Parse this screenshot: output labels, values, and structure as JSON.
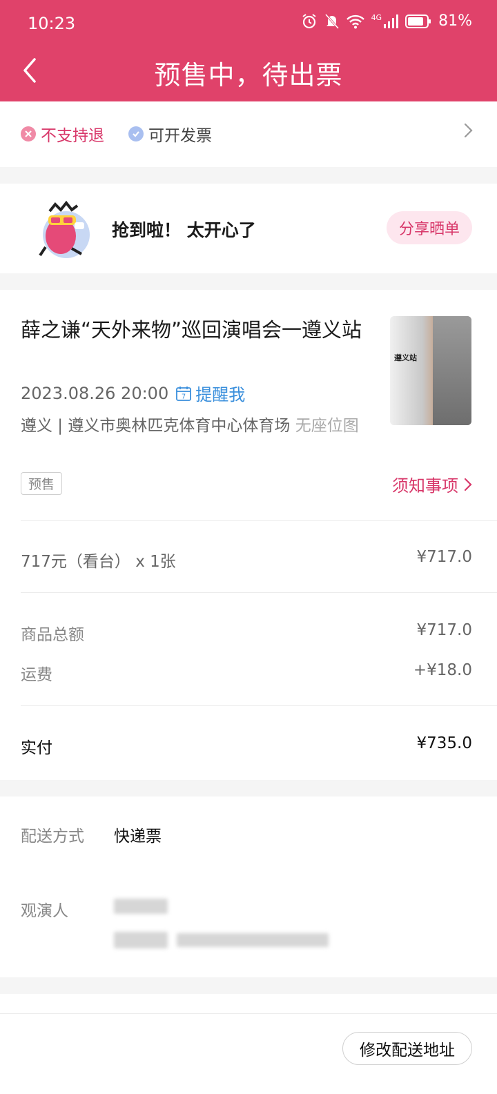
{
  "status_bar": {
    "time": "10:23",
    "battery": "81%",
    "network": "4G"
  },
  "header": {
    "title": "预售中，待出票",
    "background_color": "#e0426a"
  },
  "policies": {
    "no_refund": "不支持退",
    "invoice": "可开发票"
  },
  "share": {
    "message": "抢到啦！ 太开心了",
    "button": "分享晒单"
  },
  "event": {
    "title": "薛之谦“天外来物”巡回演唱会一遵义站",
    "datetime": "2023.08.26 20:00",
    "remind": "提醒我",
    "calendar_day": "7",
    "venue": "遵义 | 遵义市奥林匹克体育中心体育场",
    "seat_note": "无座位图",
    "tag": "预售",
    "notice": "须知事项",
    "poster_text": "遵义站"
  },
  "ticket": {
    "description": "717元（看台） x 1张",
    "price": "¥717.0"
  },
  "summary": {
    "subtotal_label": "商品总额",
    "subtotal": "¥717.0",
    "shipping_label": "运费",
    "shipping": "+¥18.0",
    "paid_label": "实付",
    "paid": "¥735.0"
  },
  "delivery": {
    "method_label": "配送方式",
    "method": "快递票",
    "viewer_label": "观演人"
  },
  "footer": {
    "modify_address": "修改配送地址"
  }
}
